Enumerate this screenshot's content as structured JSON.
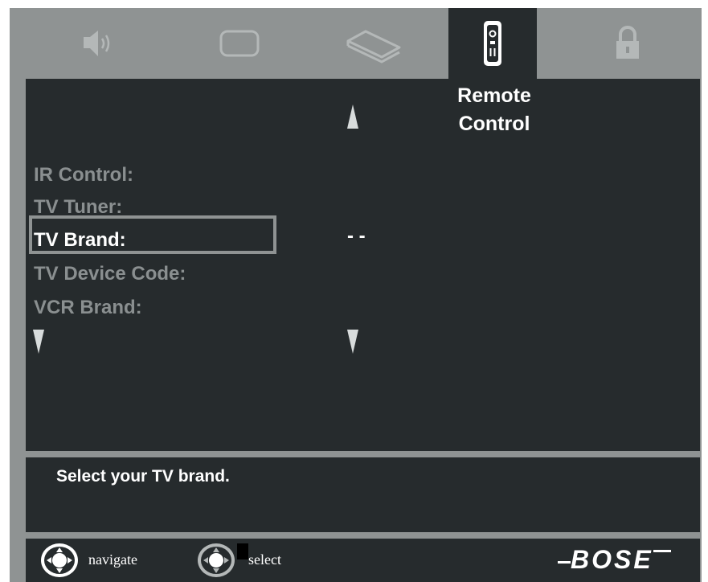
{
  "tabs": [
    {
      "icon": "speaker-icon",
      "active": false
    },
    {
      "icon": "tv-screen-icon",
      "active": false
    },
    {
      "icon": "source-device-icon",
      "active": false
    },
    {
      "icon": "remote-control-icon",
      "active": true
    },
    {
      "icon": "lock-icon",
      "active": false
    }
  ],
  "active_tab": {
    "label": "Remote\nControl"
  },
  "menu": {
    "items": [
      {
        "label": "IR Control:",
        "value": ""
      },
      {
        "label": "TV Tuner:",
        "value": ""
      },
      {
        "label": "TV Brand:",
        "value": "- -",
        "selected": true
      },
      {
        "label": "TV Device Code:",
        "value": ""
      },
      {
        "label": "VCR Brand:",
        "value": ""
      }
    ]
  },
  "help": {
    "text": "Select your TV brand."
  },
  "footer": {
    "navigate_label": "navigate",
    "select_label": "select",
    "brand": "BOSE"
  },
  "colors": {
    "frame": "#8f9393",
    "panel": "#262b2d",
    "inactive_text": "#8a8f90",
    "active_text": "#ffffff"
  }
}
